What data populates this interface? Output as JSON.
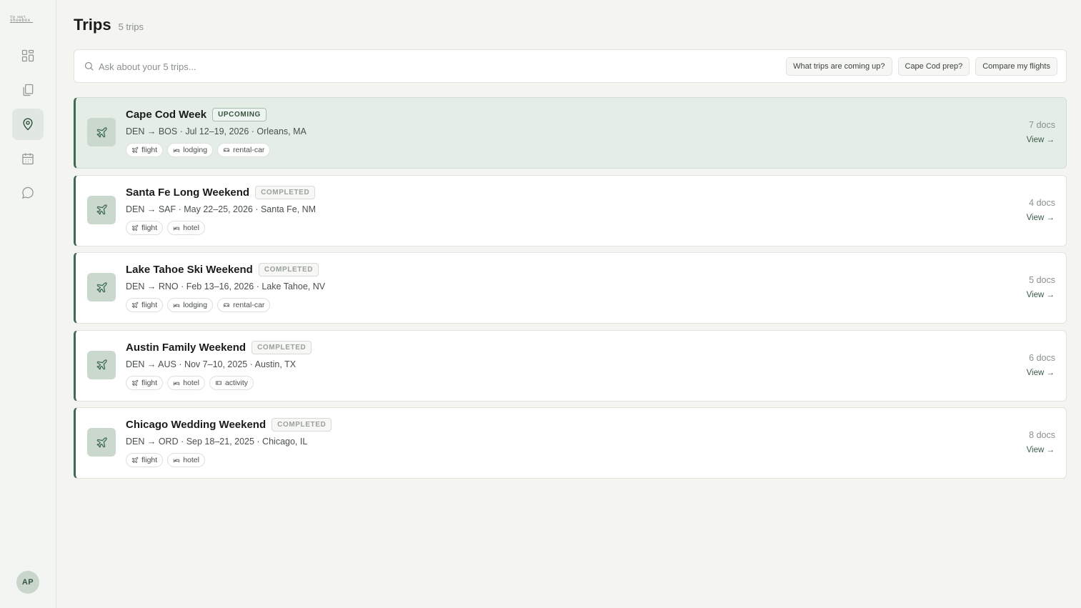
{
  "brand": {
    "line1": "the smart",
    "line2": "shoebox"
  },
  "nav": [
    {
      "name": "dashboard",
      "icon": "grid-icon",
      "active": false
    },
    {
      "name": "documents",
      "icon": "documents-icon",
      "active": false
    },
    {
      "name": "trips",
      "icon": "map-pin-icon",
      "active": true
    },
    {
      "name": "calendar",
      "icon": "calendar-icon",
      "active": false
    },
    {
      "name": "chat",
      "icon": "chat-bubble-icon",
      "active": false
    }
  ],
  "user": {
    "initials": "AP"
  },
  "page": {
    "title": "Trips",
    "count": "5 trips"
  },
  "search": {
    "placeholder": "Ask about your 5 trips...",
    "value": "",
    "suggestions": [
      "What trips are coming up?",
      "Cape Cod prep?",
      "Compare my flights"
    ]
  },
  "trips": [
    {
      "title": "Cape Cod Week",
      "status": "UPCOMING",
      "meta": "DEN → BOS · Jul 12–19, 2026 · Orleans, MA",
      "tags": [
        {
          "label": "flight",
          "icon": "plane-icon"
        },
        {
          "label": "lodging",
          "icon": "bed-icon"
        },
        {
          "label": "rental-car",
          "icon": "car-icon"
        }
      ],
      "docs": "7 docs",
      "view": "View →"
    },
    {
      "title": "Santa Fe Long Weekend",
      "status": "COMPLETED",
      "meta": "DEN → SAF · May 22–25, 2026 · Santa Fe, NM",
      "tags": [
        {
          "label": "flight",
          "icon": "plane-icon"
        },
        {
          "label": "hotel",
          "icon": "bed-icon"
        }
      ],
      "docs": "4 docs",
      "view": "View →"
    },
    {
      "title": "Lake Tahoe Ski Weekend",
      "status": "COMPLETED",
      "meta": "DEN → RNO · Feb 13–16, 2026 · Lake Tahoe, NV",
      "tags": [
        {
          "label": "flight",
          "icon": "plane-icon"
        },
        {
          "label": "lodging",
          "icon": "bed-icon"
        },
        {
          "label": "rental-car",
          "icon": "car-icon"
        }
      ],
      "docs": "5 docs",
      "view": "View →"
    },
    {
      "title": "Austin Family Weekend",
      "status": "COMPLETED",
      "meta": "DEN → AUS · Nov 7–10, 2025 · Austin, TX",
      "tags": [
        {
          "label": "flight",
          "icon": "plane-icon"
        },
        {
          "label": "hotel",
          "icon": "bed-icon"
        },
        {
          "label": "activity",
          "icon": "ticket-icon"
        }
      ],
      "docs": "6 docs",
      "view": "View →"
    },
    {
      "title": "Chicago Wedding Weekend",
      "status": "COMPLETED",
      "meta": "DEN → ORD · Sep 18–21, 2025 · Chicago, IL",
      "tags": [
        {
          "label": "flight",
          "icon": "plane-icon"
        },
        {
          "label": "hotel",
          "icon": "bed-icon"
        }
      ],
      "docs": "8 docs",
      "view": "View →"
    }
  ],
  "colors": {
    "accent": "#3e6a52",
    "active_card": "#e4eee7",
    "background": "#f4f5f1"
  }
}
